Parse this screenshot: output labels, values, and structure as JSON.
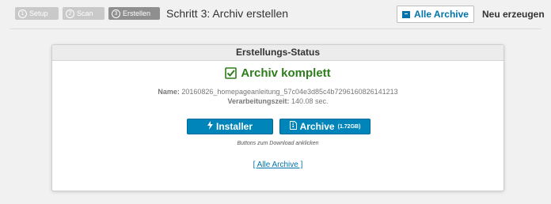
{
  "steps": [
    {
      "num": "1",
      "label": "Setup"
    },
    {
      "num": "2",
      "label": "Scan"
    },
    {
      "num": "3",
      "label": "Erstellen"
    }
  ],
  "step_title": "Schritt 3: Archiv erstellen",
  "top_buttons": {
    "all_archives": "Alle Archive",
    "new_create": "Neu erzeugen"
  },
  "panel": {
    "title": "Erstellungs-Status",
    "status": "Archiv komplett",
    "name_label": "Name:",
    "name_value": "20160826_homepageanleitung_57c04e3d85c4b7296160826141213",
    "time_label": "Verarbeitungszeit:",
    "time_value": "140.08 sec.",
    "installer_label": "Installer",
    "archive_label": "Archive",
    "archive_size": "(1.72GB)",
    "hint": "Buttons zum Download anklicken",
    "all_link": "[ Alle Archive ]"
  },
  "colors": {
    "accent": "#0085ba",
    "success": "#2e7d1b",
    "step_inactive": "#c9c9c9",
    "step_active": "#8f8f8f"
  }
}
